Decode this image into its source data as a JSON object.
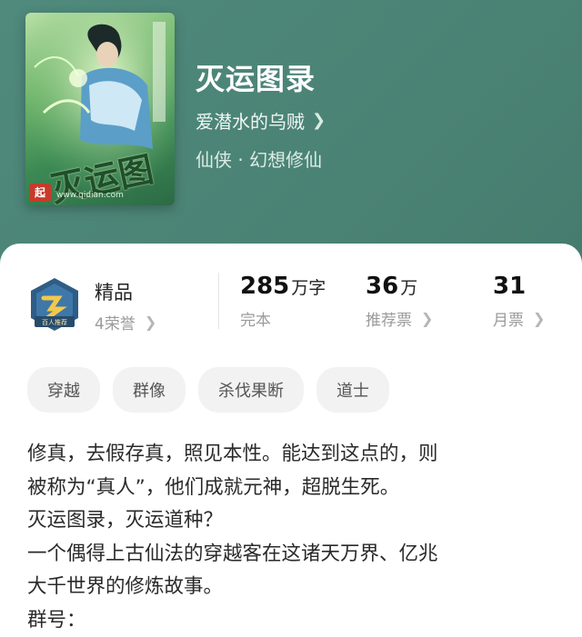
{
  "book": {
    "title": "灭运图录",
    "author": "爱潜水的乌贼",
    "genre": "仙侠 · 幻想修仙",
    "cover": {
      "calligraphy": "灭运图录",
      "site": "www.qidian.com",
      "logo_text": "起"
    }
  },
  "quality": {
    "label": "精品",
    "honor": "4荣誉",
    "badge_text": "百人推荐"
  },
  "stats": [
    {
      "value": "285",
      "unit": "万字",
      "label": "完本"
    },
    {
      "value": "36",
      "unit": "万",
      "label": "推荐票"
    },
    {
      "value": "31",
      "unit": "",
      "label": "月票"
    }
  ],
  "tags": [
    "穿越",
    "群像",
    "杀伐果断",
    "道士"
  ],
  "description": [
    "修真，去假存真，照见本性。能达到这点的，则",
    "被称为“真人”，他们成就元神，超脱生死。",
    "灭运图录，灭运道种？",
    "一个偶得上古仙法的穿越客在这诸天万界、亿兆",
    "大千世界的修炼故事。",
    "群号："
  ],
  "icons": {
    "chevron": "chevron-right-icon"
  }
}
